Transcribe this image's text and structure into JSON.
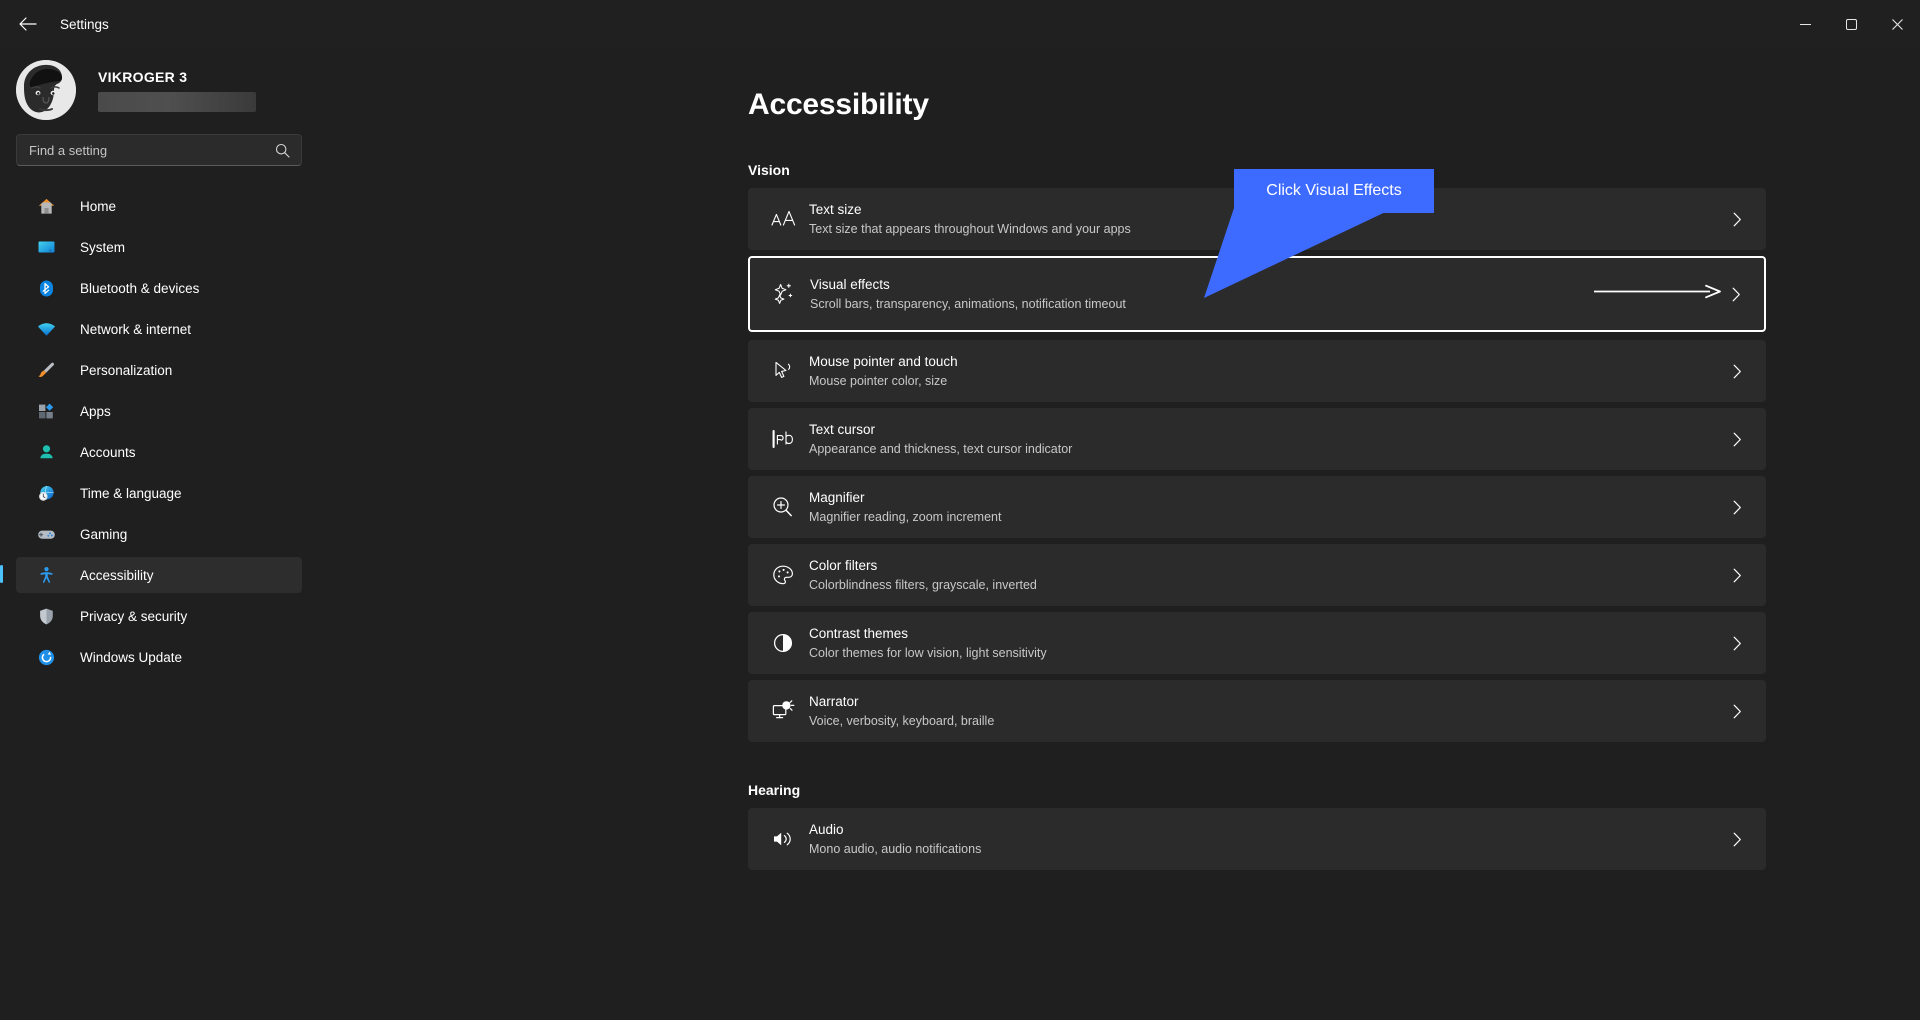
{
  "window": {
    "title": "Settings",
    "back_icon": "back-arrow-icon",
    "minimize_label": "Minimize",
    "maximize_label": "Maximize",
    "close_label": "Close"
  },
  "account": {
    "name": "VIKROGER 3",
    "email_redacted": ""
  },
  "search": {
    "placeholder": "Find a setting",
    "value": "",
    "icon": "search-icon"
  },
  "sidebar": {
    "items": [
      {
        "label": "Home",
        "icon": "home-icon",
        "selected": false
      },
      {
        "label": "System",
        "icon": "system-icon",
        "selected": false
      },
      {
        "label": "Bluetooth & devices",
        "icon": "bluetooth-icon",
        "selected": false
      },
      {
        "label": "Network & internet",
        "icon": "network-icon",
        "selected": false
      },
      {
        "label": "Personalization",
        "icon": "brush-icon",
        "selected": false
      },
      {
        "label": "Apps",
        "icon": "apps-icon",
        "selected": false
      },
      {
        "label": "Accounts",
        "icon": "account-icon",
        "selected": false
      },
      {
        "label": "Time & language",
        "icon": "clock-globe-icon",
        "selected": false
      },
      {
        "label": "Gaming",
        "icon": "gamepad-icon",
        "selected": false
      },
      {
        "label": "Accessibility",
        "icon": "accessibility-icon",
        "selected": true
      },
      {
        "label": "Privacy & security",
        "icon": "shield-icon",
        "selected": false
      },
      {
        "label": "Windows Update",
        "icon": "update-icon",
        "selected": false
      }
    ]
  },
  "page": {
    "title": "Accessibility",
    "sections": [
      {
        "heading": "Vision",
        "rows": [
          {
            "title": "Text size",
            "sub": "Text size that appears throughout Windows and your apps",
            "icon": "text-size-icon",
            "highlighted": false
          },
          {
            "title": "Visual effects",
            "sub": "Scroll bars, transparency, animations, notification timeout",
            "icon": "visual-effects-icon",
            "highlighted": true
          },
          {
            "title": "Mouse pointer and touch",
            "sub": "Mouse pointer color, size",
            "icon": "mouse-pointer-icon",
            "highlighted": false
          },
          {
            "title": "Text cursor",
            "sub": "Appearance and thickness, text cursor indicator",
            "icon": "text-cursor-icon",
            "highlighted": false
          },
          {
            "title": "Magnifier",
            "sub": "Magnifier reading, zoom increment",
            "icon": "magnifier-icon",
            "highlighted": false
          },
          {
            "title": "Color filters",
            "sub": "Colorblindness filters, grayscale, inverted",
            "icon": "color-filters-icon",
            "highlighted": false
          },
          {
            "title": "Contrast themes",
            "sub": "Color themes for low vision, light sensitivity",
            "icon": "contrast-icon",
            "highlighted": false
          },
          {
            "title": "Narrator",
            "sub": "Voice, verbosity, keyboard, braille",
            "icon": "narrator-icon",
            "highlighted": false
          }
        ]
      },
      {
        "heading": "Hearing",
        "rows": [
          {
            "title": "Audio",
            "sub": "Mono audio, audio notifications",
            "icon": "audio-icon",
            "highlighted": false
          }
        ]
      }
    ]
  },
  "annotation": {
    "callout_text": "Click Visual Effects",
    "callout_color": "#3e6bff",
    "arrow_color": "#ffffff"
  },
  "colors": {
    "background": "#1f1f1f",
    "card": "#2b2b2b",
    "accent": "#4cc2ff",
    "highlight_border": "#ffffff"
  }
}
